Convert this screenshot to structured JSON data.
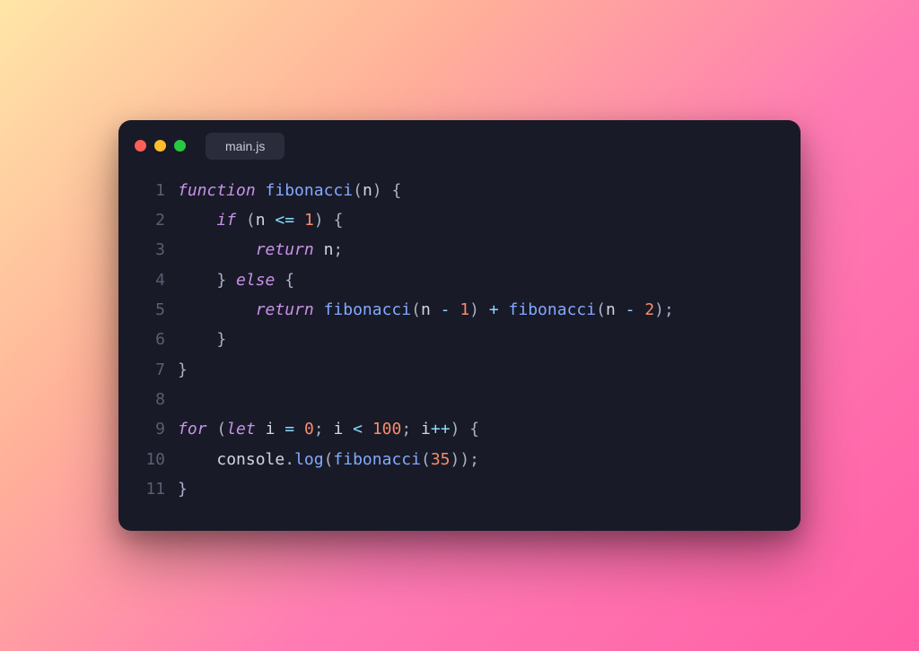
{
  "window": {
    "tab_label": "main.js",
    "traffic_lights": [
      "close",
      "minimize",
      "zoom"
    ]
  },
  "code": {
    "language": "javascript",
    "lines": [
      {
        "n": "1",
        "tokens": [
          {
            "t": "function ",
            "c": "keyword"
          },
          {
            "t": "fibonacci",
            "c": "fn"
          },
          {
            "t": "(",
            "c": "punc"
          },
          {
            "t": "n",
            "c": "param"
          },
          {
            "t": ") {",
            "c": "punc"
          }
        ]
      },
      {
        "n": "2",
        "tokens": [
          {
            "t": "    ",
            "c": "default"
          },
          {
            "t": "if ",
            "c": "keyword"
          },
          {
            "t": "(",
            "c": "punc"
          },
          {
            "t": "n ",
            "c": "ident"
          },
          {
            "t": "<=",
            "c": "op"
          },
          {
            "t": " ",
            "c": "default"
          },
          {
            "t": "1",
            "c": "num"
          },
          {
            "t": ") {",
            "c": "punc"
          }
        ]
      },
      {
        "n": "3",
        "tokens": [
          {
            "t": "        ",
            "c": "default"
          },
          {
            "t": "return ",
            "c": "keyword"
          },
          {
            "t": "n",
            "c": "ident"
          },
          {
            "t": ";",
            "c": "punc"
          }
        ]
      },
      {
        "n": "4",
        "tokens": [
          {
            "t": "    } ",
            "c": "punc"
          },
          {
            "t": "else",
            "c": "keyword"
          },
          {
            "t": " {",
            "c": "punc"
          }
        ]
      },
      {
        "n": "5",
        "tokens": [
          {
            "t": "        ",
            "c": "default"
          },
          {
            "t": "return ",
            "c": "keyword"
          },
          {
            "t": "fibonacci",
            "c": "fn"
          },
          {
            "t": "(",
            "c": "punc"
          },
          {
            "t": "n ",
            "c": "ident"
          },
          {
            "t": "-",
            "c": "op"
          },
          {
            "t": " ",
            "c": "default"
          },
          {
            "t": "1",
            "c": "num"
          },
          {
            "t": ") ",
            "c": "punc"
          },
          {
            "t": "+",
            "c": "op"
          },
          {
            "t": " ",
            "c": "default"
          },
          {
            "t": "fibonacci",
            "c": "fn"
          },
          {
            "t": "(",
            "c": "punc"
          },
          {
            "t": "n ",
            "c": "ident"
          },
          {
            "t": "-",
            "c": "op"
          },
          {
            "t": " ",
            "c": "default"
          },
          {
            "t": "2",
            "c": "num"
          },
          {
            "t": ");",
            "c": "punc"
          }
        ]
      },
      {
        "n": "6",
        "tokens": [
          {
            "t": "    }",
            "c": "punc"
          }
        ]
      },
      {
        "n": "7",
        "tokens": [
          {
            "t": "}",
            "c": "punc"
          }
        ]
      },
      {
        "n": "8",
        "tokens": [
          {
            "t": "",
            "c": "default"
          }
        ]
      },
      {
        "n": "9",
        "tokens": [
          {
            "t": "for ",
            "c": "keyword"
          },
          {
            "t": "(",
            "c": "punc"
          },
          {
            "t": "let ",
            "c": "keyword"
          },
          {
            "t": "i ",
            "c": "ident"
          },
          {
            "t": "=",
            "c": "op"
          },
          {
            "t": " ",
            "c": "default"
          },
          {
            "t": "0",
            "c": "num"
          },
          {
            "t": "; ",
            "c": "punc"
          },
          {
            "t": "i ",
            "c": "ident"
          },
          {
            "t": "<",
            "c": "op"
          },
          {
            "t": " ",
            "c": "default"
          },
          {
            "t": "100",
            "c": "num"
          },
          {
            "t": "; ",
            "c": "punc"
          },
          {
            "t": "i",
            "c": "ident"
          },
          {
            "t": "++",
            "c": "op"
          },
          {
            "t": ") {",
            "c": "punc"
          }
        ]
      },
      {
        "n": "10",
        "tokens": [
          {
            "t": "    ",
            "c": "default"
          },
          {
            "t": "console",
            "c": "ident"
          },
          {
            "t": ".",
            "c": "punc"
          },
          {
            "t": "log",
            "c": "fn"
          },
          {
            "t": "(",
            "c": "punc"
          },
          {
            "t": "fibonacci",
            "c": "fn"
          },
          {
            "t": "(",
            "c": "punc"
          },
          {
            "t": "35",
            "c": "num"
          },
          {
            "t": "));",
            "c": "punc"
          }
        ]
      },
      {
        "n": "11",
        "tokens": [
          {
            "t": "}",
            "c": "punc"
          }
        ]
      }
    ]
  },
  "colors": {
    "background": "#191a27",
    "keyword": "#c792ea",
    "function": "#82aaff",
    "number": "#f78c6c",
    "operator": "#89ddff",
    "punctuation": "#a9b2c8",
    "identifier": "#d0d5e6",
    "line_number": "#5a5e73"
  }
}
